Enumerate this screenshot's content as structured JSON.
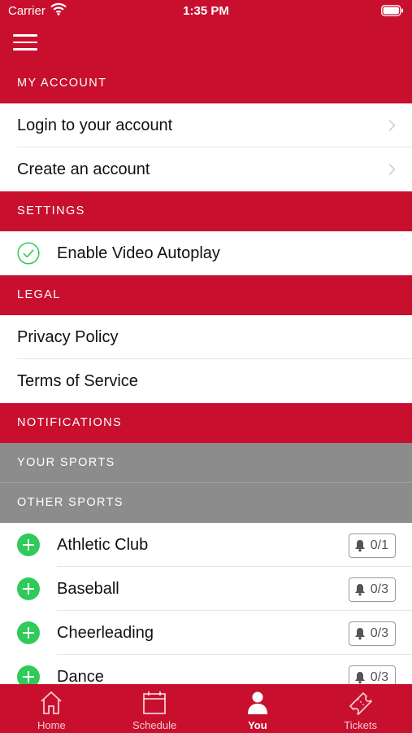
{
  "status_bar": {
    "carrier": "Carrier",
    "time": "1:35 PM"
  },
  "sections": {
    "my_account": "MY ACCOUNT",
    "settings": "SETTINGS",
    "legal": "LEGAL",
    "notifications": "NOTIFICATIONS",
    "your_sports": "YOUR SPORTS",
    "other_sports": "OTHER SPORTS"
  },
  "account": {
    "login": "Login to your account",
    "create": "Create an account"
  },
  "settings": {
    "autoplay": "Enable Video Autoplay",
    "autoplay_enabled": true
  },
  "legal": {
    "privacy": "Privacy Policy",
    "terms": "Terms of Service"
  },
  "sports": [
    {
      "name": "Athletic Club",
      "count": "0/1"
    },
    {
      "name": "Baseball",
      "count": "0/3"
    },
    {
      "name": "Cheerleading",
      "count": "0/3"
    },
    {
      "name": "Dance",
      "count": "0/3"
    }
  ],
  "tabs": [
    {
      "label": "Home",
      "icon": "home-icon",
      "active": false
    },
    {
      "label": "Schedule",
      "icon": "calendar-icon",
      "active": false
    },
    {
      "label": "You",
      "icon": "person-icon",
      "active": true
    },
    {
      "label": "Tickets",
      "icon": "ticket-icon",
      "active": false
    }
  ],
  "colors": {
    "brand": "#c8102e",
    "subheader": "#8c8c8c",
    "add": "#2fca5a",
    "check": "#2fca5a"
  }
}
